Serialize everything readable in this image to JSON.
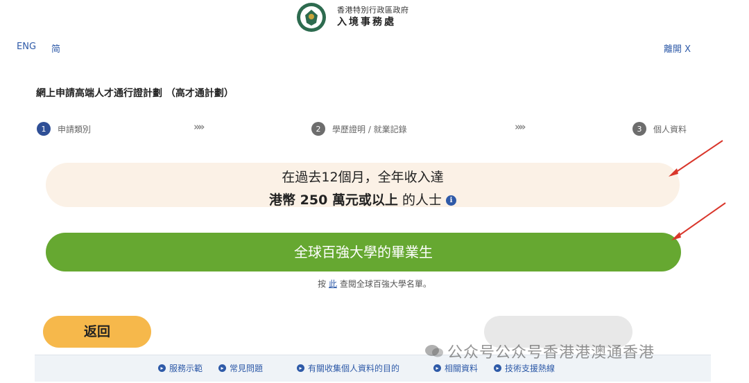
{
  "header": {
    "dept_small": "香港特別行政區政府",
    "dept_name": "入境事務處",
    "lang_eng": "ENG",
    "lang_sc": "简",
    "logout": "離開 X"
  },
  "page_title": "網上申請高端人才通行證計劃 （高才通計劃）",
  "steps": [
    {
      "num": "1",
      "label": "申請類別"
    },
    {
      "num": "2",
      "label": "學歷證明 / 就業記錄"
    },
    {
      "num": "3",
      "label": "個人資料"
    }
  ],
  "step_separator": "»»",
  "option_income": {
    "line1": "在過去12個月，全年收入達",
    "line2_bold": "港幣 250 萬元或以上",
    "line2_rest": " 的人士",
    "info": "i"
  },
  "option_university": {
    "label": "全球百強大學的畢業生"
  },
  "hint": {
    "prefix": "按 ",
    "link": "此",
    "suffix": " 查閱全球百強大學名單。"
  },
  "buttons": {
    "back": "返回"
  },
  "footer_links": [
    "服務示範",
    "常見問題",
    "有關收集個人資料的目的",
    "相關資料",
    "技術支援熱線"
  ],
  "watermark": "公众号公众号香港港澳通香港",
  "colors": {
    "primary_blue": "#2e5aa8",
    "option_green": "#66a831",
    "option_cream": "#fbf1e6",
    "back_orange": "#f6b84b",
    "arrow_red": "#d9362b"
  }
}
